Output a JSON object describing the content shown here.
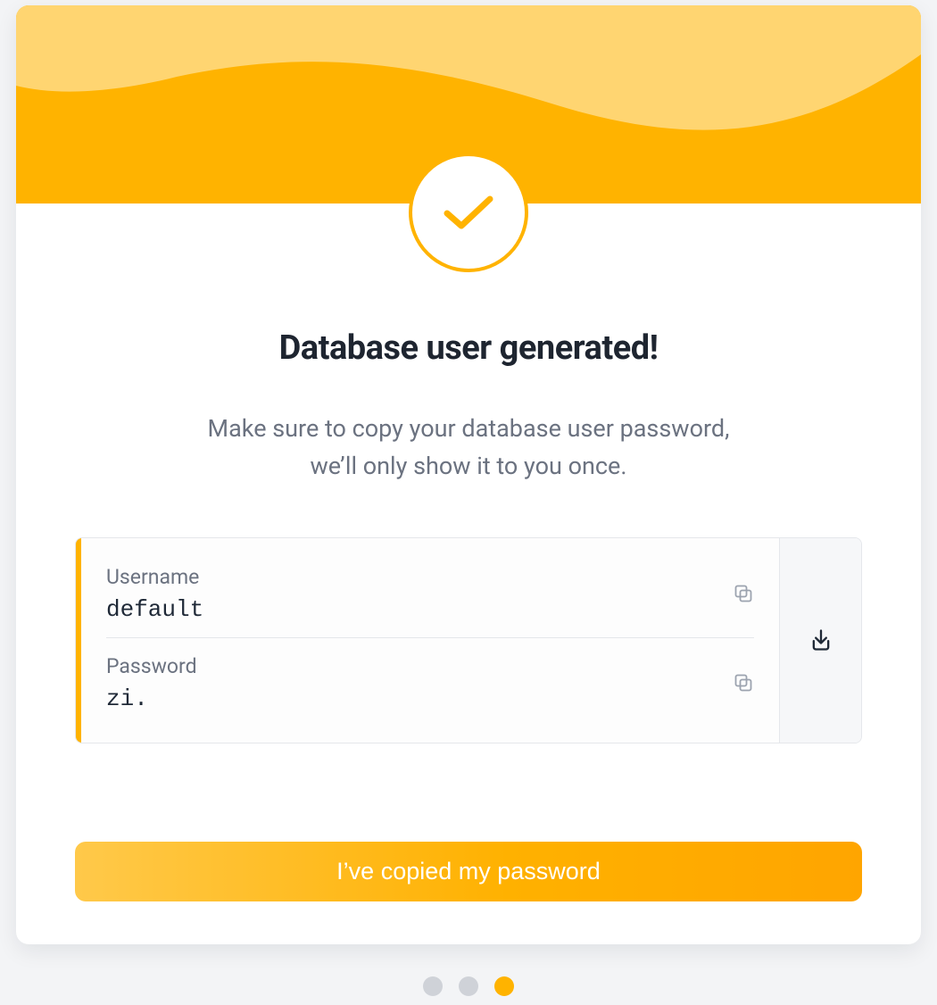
{
  "header": {
    "icon": "check-icon"
  },
  "main": {
    "title": "Database user generated!",
    "subtitle_line1": "Make sure to copy your database user password,",
    "subtitle_line2": "we’ll only show it to you once."
  },
  "credentials": {
    "username_label": "Username",
    "username_value": "default",
    "password_label": "Password",
    "password_value": "zi."
  },
  "actions": {
    "confirm_label": "I’ve copied my password"
  },
  "pagination": {
    "total": 3,
    "active_index": 2
  },
  "colors": {
    "accent": "#ffb300",
    "accent_light": "#ffd571",
    "text_primary": "#1e2530",
    "text_secondary": "#6b7280"
  }
}
